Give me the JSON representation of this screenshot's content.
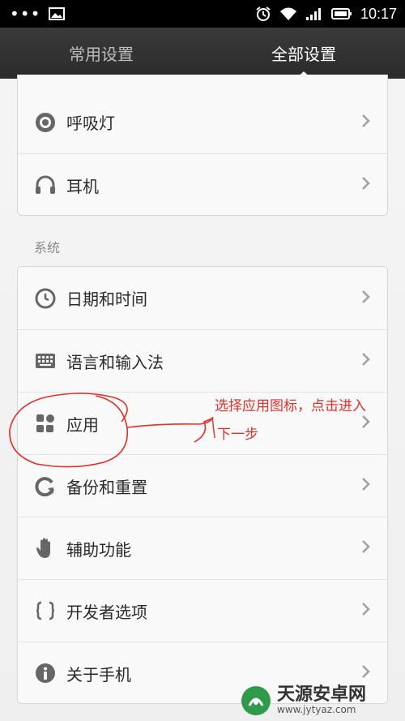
{
  "status_bar": {
    "time": "10:17"
  },
  "tabs": [
    {
      "label": "常用设置",
      "active": false
    },
    {
      "label": "全部设置",
      "active": true
    }
  ],
  "top_group": [
    {
      "label": "呼吸灯",
      "icon": "breathing-light-icon"
    },
    {
      "label": "耳机",
      "icon": "headphones-icon"
    }
  ],
  "system": {
    "title": "系统",
    "items": [
      {
        "label": "日期和时间",
        "icon": "clock-icon"
      },
      {
        "label": "语言和输入法",
        "icon": "keyboard-icon"
      },
      {
        "label": "应用",
        "icon": "apps-icon"
      },
      {
        "label": "备份和重置",
        "icon": "refresh-icon"
      },
      {
        "label": "辅助功能",
        "icon": "hand-icon"
      },
      {
        "label": "开发者选项",
        "icon": "braces-icon"
      },
      {
        "label": "关于手机",
        "icon": "info-icon"
      }
    ]
  },
  "annotation": {
    "line1": "选择应用图标，点击进入",
    "line2": "下一步",
    "color": "#e0302a"
  },
  "watermark": {
    "title": "天源安卓网",
    "url": "www.jytyaz.com"
  }
}
